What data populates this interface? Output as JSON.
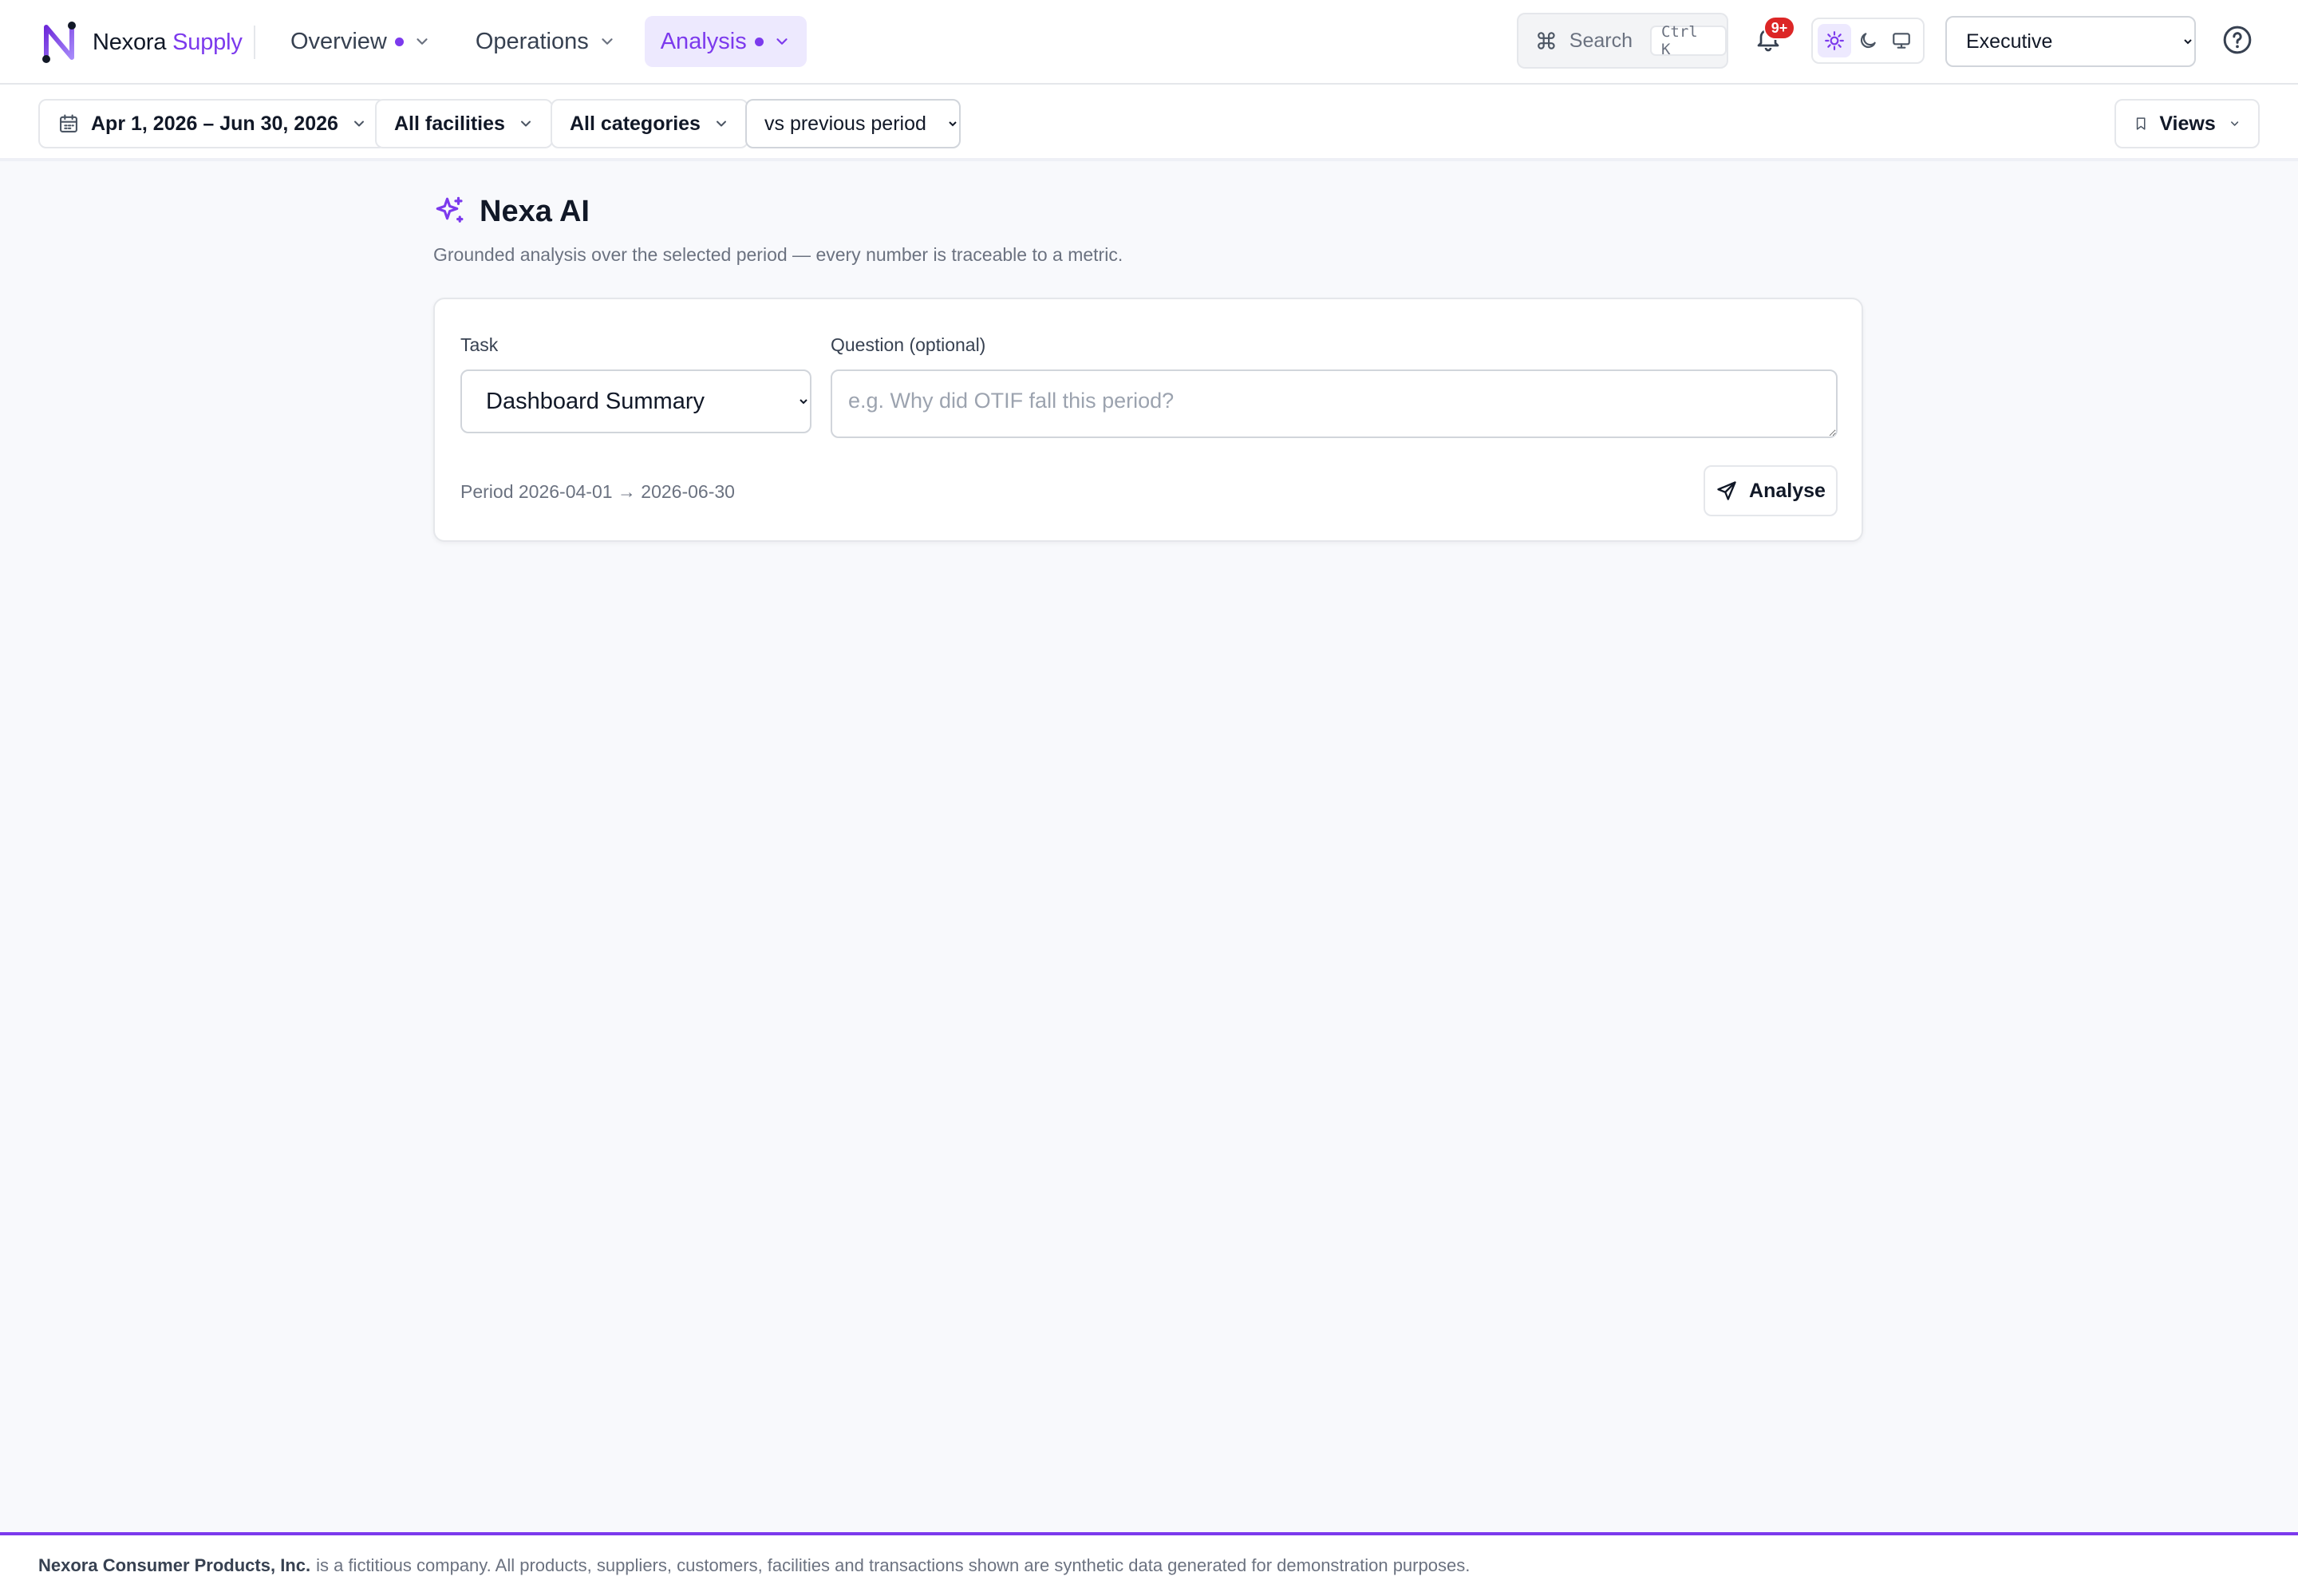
{
  "brand": {
    "name": "Nexora",
    "accent": "Supply",
    "color": "#7c3aed"
  },
  "nav": {
    "overview": "Overview",
    "operations": "Operations",
    "analysis": "Analysis"
  },
  "search": {
    "label": "Search",
    "shortcut": "Ctrl K"
  },
  "notifications": {
    "badge": "9+"
  },
  "theme": {
    "active": "light"
  },
  "role": {
    "selected": "Executive"
  },
  "filters": {
    "date_range": "Apr 1, 2026 – Jun 30, 2026",
    "facilities": "All facilities",
    "categories": "All categories",
    "comparison": "vs previous period",
    "views": "Views"
  },
  "page": {
    "title": "Nexa AI",
    "subtitle": "Grounded analysis over the selected period — every number is traceable to a metric."
  },
  "form": {
    "task_label": "Task",
    "task_value": "Dashboard Summary",
    "question_label": "Question (optional)",
    "question_placeholder": "e.g. Why did OTIF fall this period?",
    "period": "Period 2026-04-01 → 2026-06-30",
    "submit": "Analyse"
  },
  "footer": {
    "company": "Nexora Consumer Products, Inc.",
    "notice": "is a fictitious company. All products, suppliers, customers, facilities and transactions shown are synthetic data generated for demonstration purposes."
  }
}
